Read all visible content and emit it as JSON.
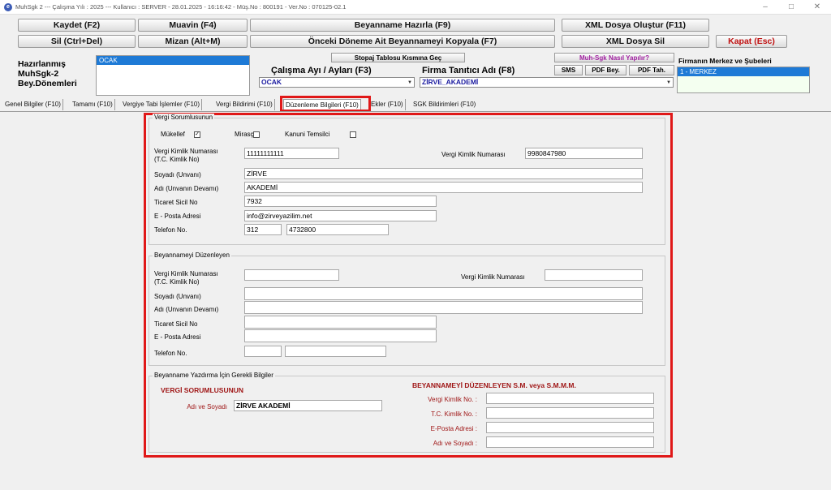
{
  "titlebar": {
    "icon_letter": "e",
    "text": "MuhSgk 2  ---  Çalışma Yılı : 2025  ---  Kullanıcı : SERVER - 28.01.2025 - 16:16:42 - Müş.No : 800191  - Ver.No : 070125-02.1"
  },
  "toolbar": {
    "kaydet": "Kaydet (F2)",
    "muavin": "Muavin (F4)",
    "beyanname_hazirla": "Beyanname Hazırla (F9)",
    "xml_olustur": "XML Dosya Oluştur (F11)",
    "sil": "Sil (Ctrl+Del)",
    "mizan": "Mizan (Alt+M)",
    "onceki_kopyala": "Önceki Döneme Ait Beyannameyi Kopyala (F7)",
    "xml_sil": "XML Dosya Sil",
    "kapat": "Kapat (Esc)"
  },
  "left_label": {
    "line1": "Hazırlanmış",
    "line2": "MuhSgk-2",
    "line3": "Bey.Dönemleri"
  },
  "period_list": [
    "OCAK"
  ],
  "stopaj_button": "Stopaj Tablosu Kısmına Geç",
  "calisma_ayi": {
    "label": "Çalışma Ayı / Ayları (F3)",
    "value": "OCAK"
  },
  "firma": {
    "label": "Firma Tanıtıcı Adı (F8)",
    "value": "ZİRVE_AKADEMİ"
  },
  "help_button": "Muh-Sgk Nasıl Yapılır?",
  "small_buttons": {
    "sms": "SMS",
    "pdf_bey": "PDF Bey.",
    "pdf_tah": "PDF Tah."
  },
  "branches": {
    "title": "Firmanın Merkez ve Şubeleri",
    "items": [
      "1 - MERKEZ"
    ]
  },
  "tabs": [
    "Genel Bilgiler (F10)",
    "Tamamı (F10)",
    "Vergiye Tabi İşlemler (F10)",
    "Vergi Bildirimi (F10)",
    "Düzenleme Bilgileri (F10)",
    "Ekler (F10)",
    "SGK Bildirimleri (F10)"
  ],
  "vergi_sorumlusu": {
    "title": "Vergi Sorumlusunun",
    "mukellef_label": "Mükellef",
    "mukellef_checked": true,
    "mirasci_label": "Mirasçı",
    "kanuni_label": "Kanuni Temsilci",
    "tckn_label_1": "Vergi Kimlik Numarası",
    "tckn_label_2": "(T.C. Kimlik No)",
    "tckn_value": "11111111111",
    "vkn_label": "Vergi Kimlik Numarası",
    "vkn_value": "9980847980",
    "soyadi_label": "Soyadı (Unvanı)",
    "soyadi_value": "ZİRVE",
    "adi_label": "Adı (Unvanın Devamı)",
    "adi_value": "AKADEMİ",
    "ticaret_label": "Ticaret Sicil No",
    "ticaret_value": "7932",
    "eposta_label": "E - Posta Adresi",
    "eposta_value": "info@zirveyazilim.net",
    "telefon_label": "Telefon No.",
    "telefon_alan": "312",
    "telefon_no": "4732800"
  },
  "duzenleyen": {
    "title": "Beyannameyi Düzenleyen",
    "tckn_label_1": "Vergi Kimlik Numarası",
    "tckn_label_2": "(T.C. Kimlik No)",
    "vkn_label": "Vergi Kimlik Numarası",
    "soyadi_label": "Soyadı (Unvanı)",
    "adi_label": "Adı (Unvanın Devamı)",
    "ticaret_label": "Ticaret Sicil No",
    "eposta_label": "E - Posta Adresi",
    "telefon_label": "Telefon No."
  },
  "yazdirma": {
    "title": "Beyanname Yazdırma İçin Gerekli Bilgiler",
    "sorumlu_title": "VERGİ SORUMLUSUNUN",
    "adi_soyadi_label": "Adı ve Soyadı",
    "adi_soyadi_value": "ZİRVE AKADEMİ",
    "smmm_title": "BEYANNAMEYİ DÜZENLEYEN S.M. veya S.M.M.M.",
    "vkn_label": "Vergi Kimlik No. :",
    "tckn_label": "T.C. Kimlik No. :",
    "eposta_label": "E-Posta Adresi :",
    "adsoyad_label": "Adı ve Soyadı :"
  }
}
